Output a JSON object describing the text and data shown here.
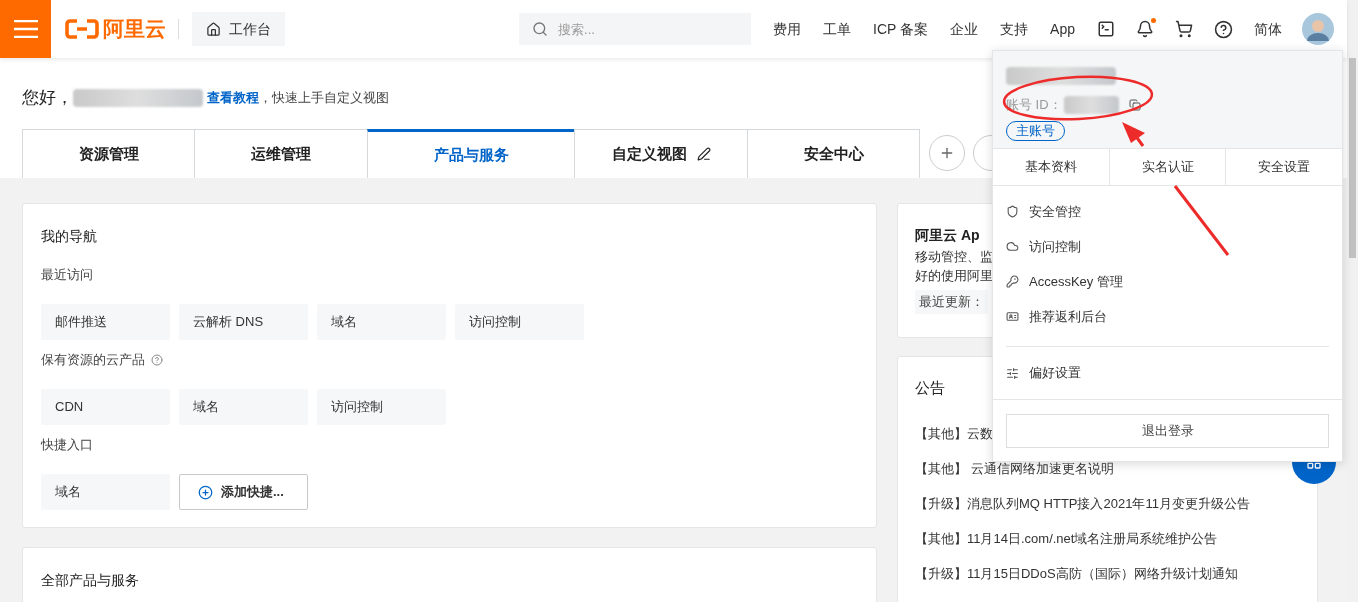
{
  "top_bar": {
    "logo": "阿里云",
    "workbench": "工作台",
    "search": {
      "placeholder": "搜索..."
    },
    "links": [
      "费用",
      "工单",
      "ICP 备案",
      "企业",
      "支持",
      "App"
    ],
    "notification_dot": true,
    "language": "简体"
  },
  "greeting": {
    "hello": "您好，",
    "link": "查看教程",
    "tail": "，快速上手自定义视图"
  },
  "view_tabs": [
    {
      "label": "资源管理",
      "selected": false,
      "editable": false
    },
    {
      "label": "运维管理",
      "selected": false,
      "editable": false
    },
    {
      "label": "产品与服务",
      "selected": true,
      "editable": false
    },
    {
      "label": "自定义视图",
      "selected": false,
      "editable": true
    },
    {
      "label": "安全中心",
      "selected": false,
      "editable": false
    }
  ],
  "nav_card": {
    "title": "我的导航",
    "sections": [
      {
        "title": "最近访问",
        "items": [
          "邮件推送",
          "云解析 DNS",
          "域名",
          "访问控制"
        ]
      },
      {
        "title": "保有资源的云产品",
        "help": true,
        "items": [
          "CDN",
          "域名",
          "访问控制"
        ]
      },
      {
        "title": "快捷入口",
        "items": [
          "域名"
        ],
        "add_button": "添加快捷..."
      }
    ]
  },
  "products_card": {
    "title": "全部产品与服务"
  },
  "app_card": {
    "title": "阿里云 Ap",
    "lines": [
      "移动管控、监",
      "好的使用阿里"
    ],
    "updated": "最近更新："
  },
  "notice_card": {
    "title": "公告",
    "items": [
      "【其他】云数",
      "【其他】 云通信网络加速更名说明",
      "【升级】消息队列MQ HTTP接入2021年11月变更升级公告",
      "【其他】11月14日.com/.net域名注册局系统维护公告",
      "【升级】11月15日DDoS高防（国际）网络升级计划通知"
    ]
  },
  "account_menu": {
    "id_label": "账号 ID：",
    "badge": "主账号",
    "tabs": [
      "基本资料",
      "实名认证",
      "安全设置"
    ],
    "items": [
      "安全管控",
      "访问控制",
      "AccessKey 管理",
      "推荐返利后台"
    ],
    "preferences": "偏好设置",
    "logout": "退出登录"
  }
}
